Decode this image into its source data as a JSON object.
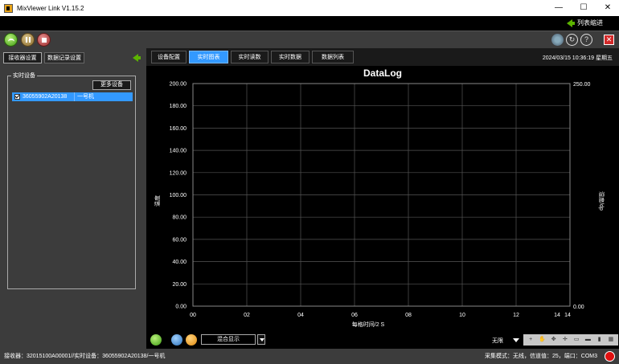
{
  "window": {
    "title": "MixViewer Link V1.15.2",
    "minimize": "—",
    "maximize": "☐",
    "close": "✕"
  },
  "header": {
    "collapse_label": "列表缩进"
  },
  "left_panel": {
    "tabs": [
      {
        "label": "接收器设置",
        "active": true
      },
      {
        "label": "数据记录设置",
        "active": false
      }
    ],
    "group_label": "实时设备",
    "more_button": "更多设备",
    "devices": [
      {
        "id": "36055902A20138",
        "name": "一号机",
        "checked": true
      }
    ]
  },
  "tabs": [
    {
      "label": "设备配置",
      "active": false
    },
    {
      "label": "实时图表",
      "active": true
    },
    {
      "label": "实时读数",
      "active": false
    },
    {
      "label": "实时数据",
      "active": false
    },
    {
      "label": "数据列表",
      "active": false
    }
  ],
  "datetime": "2024/03/15 10:36:19 星期五",
  "chart_data": {
    "type": "line",
    "title": "DataLog",
    "xlabel": "每格时间/2 S",
    "ylabel_left": "温度",
    "ylabel_right": "湿度/dp",
    "x_ticks": [
      "00",
      "02",
      "04",
      "06",
      "08",
      "10",
      "12",
      "14"
    ],
    "x_end_label": "14",
    "y_left_ticks": [
      "0.00",
      "20.00",
      "40.00",
      "60.00",
      "80.00",
      "100.00",
      "120.00",
      "140.00",
      "160.00",
      "180.00",
      "200.00"
    ],
    "y_left_range": [
      0,
      200
    ],
    "y_right_top": "250.00",
    "y_right_bottom": "0.00",
    "y_right_range": [
      0,
      250
    ],
    "xlim": [
      0,
      14
    ],
    "grid": true,
    "series": []
  },
  "bottom": {
    "display_mode": "混合显示",
    "limit_label": "无限"
  },
  "status": {
    "left": "接收器：32015100A00001//实时设备：36055902A20138/一号机",
    "right": "采集模式：无线，信道值：25，端口：COM3"
  },
  "colors": {
    "accent": "#3399ff",
    "record": "#e01010"
  }
}
